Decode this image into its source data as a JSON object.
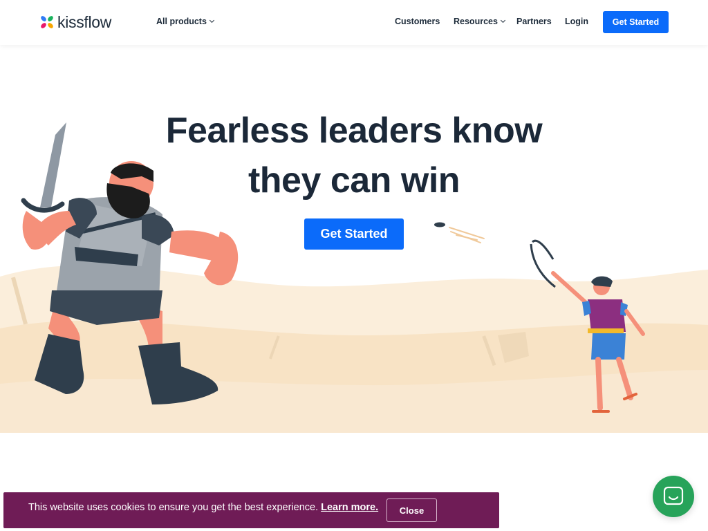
{
  "brand": {
    "name": "kissflow"
  },
  "nav": {
    "all_products": "All products",
    "customers": "Customers",
    "resources": "Resources",
    "partners": "Partners",
    "login": "Login",
    "get_started": "Get Started"
  },
  "hero": {
    "title_line1": "Fearless leaders know",
    "title_line2": "they can win",
    "cta": "Get Started"
  },
  "cookie": {
    "message": "This website uses cookies to ensure you get the best experience.",
    "learn_more": "Learn more.",
    "close": "Close"
  },
  "chat": {
    "icon": "chat-icon"
  },
  "colors": {
    "accent": "#0b6bfa",
    "cookie_bg": "#6f1c56",
    "chat_bg": "#27a35a",
    "sand": "#f9e8d1"
  }
}
